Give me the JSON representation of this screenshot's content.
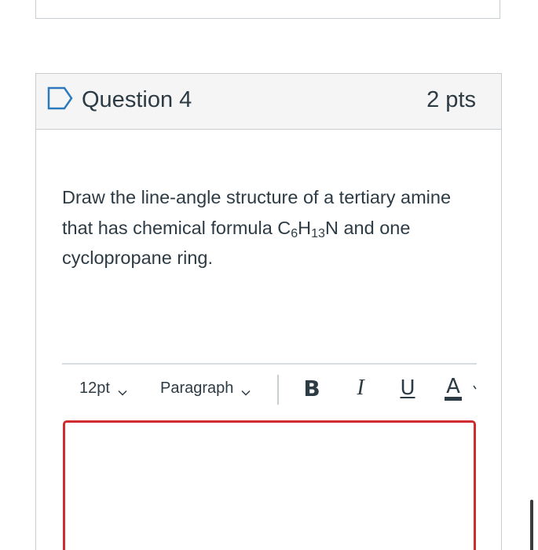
{
  "question": {
    "title": "Question 4",
    "points": "2 pts",
    "text_before": "Draw the line-angle structure of a tertiary amine that has chemical formula C",
    "subscript_1": "6",
    "text_mid": "H",
    "subscript_2": "13",
    "text_after": "N and one cyclopropane ring.",
    "flag_icon": "bookmark-flag-icon"
  },
  "editor_toolbar": {
    "font_size": "12pt",
    "block_format": "Paragraph",
    "bold_label": "B",
    "italic_label": "I",
    "underline_label": "U",
    "text_color_label": "A"
  },
  "colors": {
    "text": "#2d3b45",
    "header_bg": "#f5f5f5",
    "border": "#c7cdd1",
    "editor_focus_border": "#d02c2f"
  },
  "icons": [
    "bookmark-flag-icon",
    "chevron-down-icon",
    "bold-icon",
    "italic-icon",
    "underline-icon",
    "text-color-icon"
  ]
}
